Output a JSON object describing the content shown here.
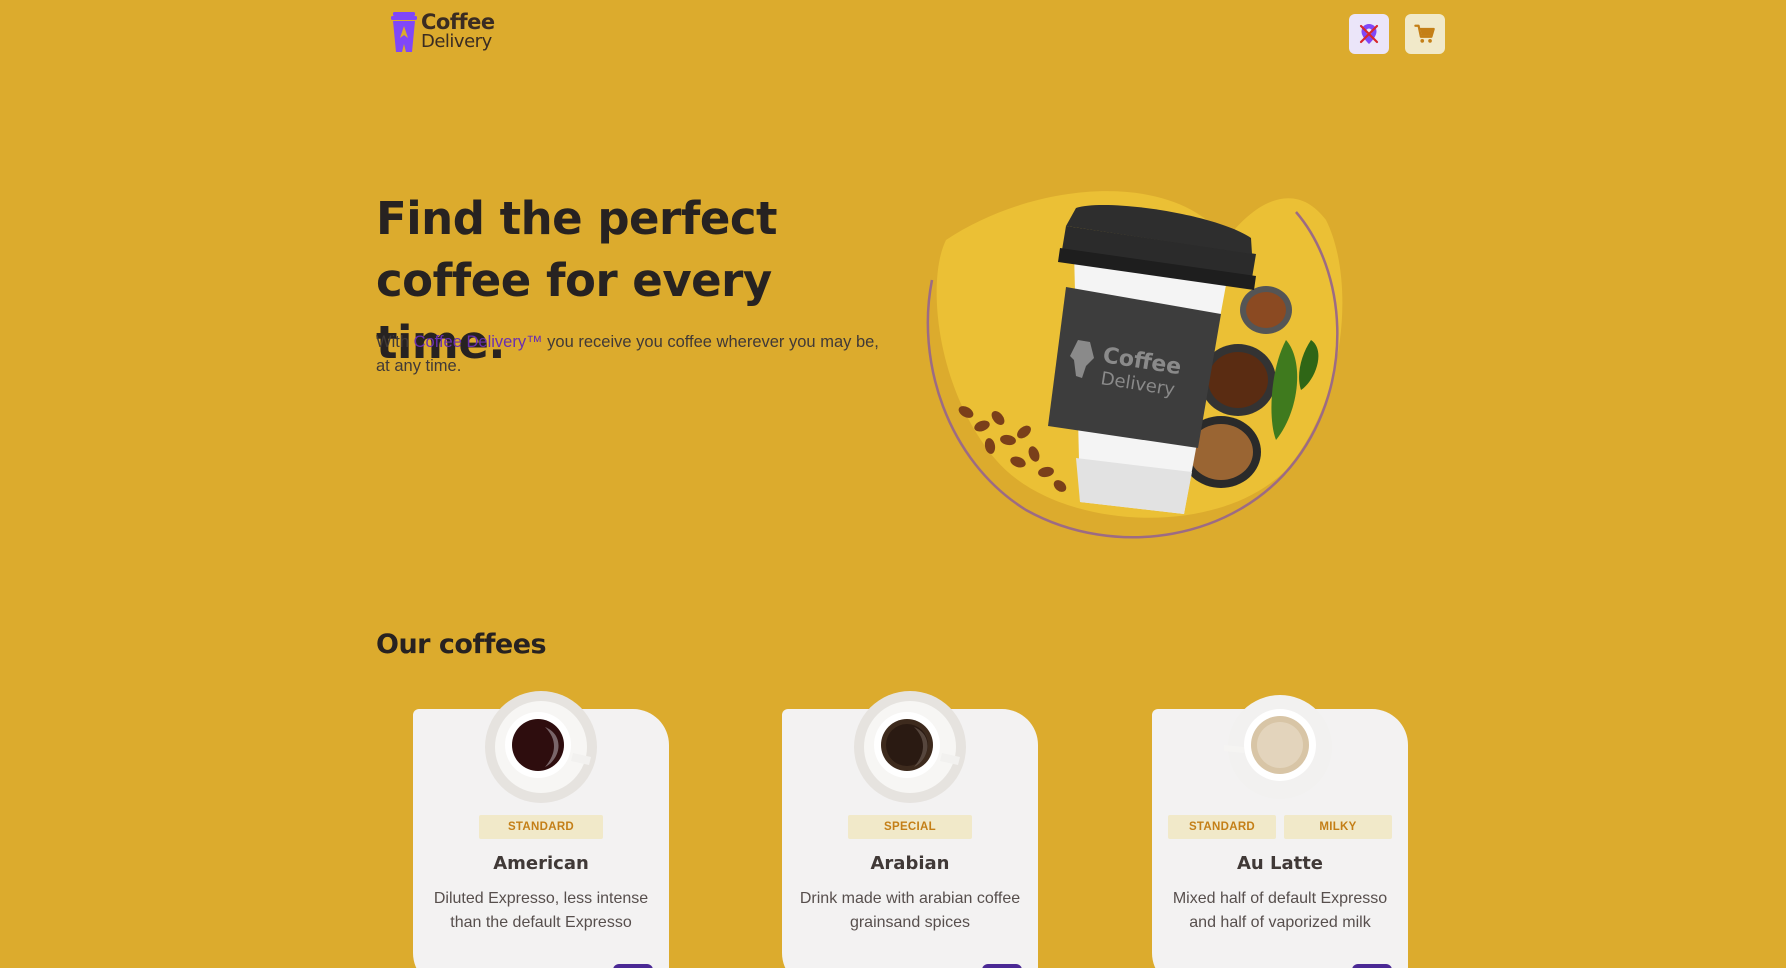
{
  "header": {
    "logo_line1": "Coffee",
    "logo_line2": "Delivery",
    "location_icon": "map-pin-off-icon",
    "cart_icon": "shopping-cart-icon"
  },
  "hero": {
    "title": "Find the perfect coffee for every time.",
    "subtitle_prefix": "With ",
    "subtitle_brand": "Coffee Delivery™",
    "subtitle_suffix": " you receive you coffee wherever you may be, at any time.",
    "cup_label_line1": "Coffee",
    "cup_label_line2": "Delivery"
  },
  "section": {
    "title": "Our coffees"
  },
  "coffees": [
    {
      "tags": [
        "STANDARD"
      ],
      "name": "American",
      "description": "Diluted Expresso, less intense than the default Expresso"
    },
    {
      "tags": [
        "SPECIAL"
      ],
      "name": "Arabian",
      "description": "Drink made with arabian coffee grainsand spices"
    },
    {
      "tags": [
        "STANDARD",
        "MILKY"
      ],
      "name": "Au Latte",
      "description": "Mixed half of default Expresso and half of vaporized milk"
    }
  ],
  "colors": {
    "background": "#dcab2d",
    "brand_purple": "#6a2fb0",
    "button_purple": "#4b2995",
    "tag_bg": "#f1e9c9",
    "tag_text": "#c47f17"
  }
}
